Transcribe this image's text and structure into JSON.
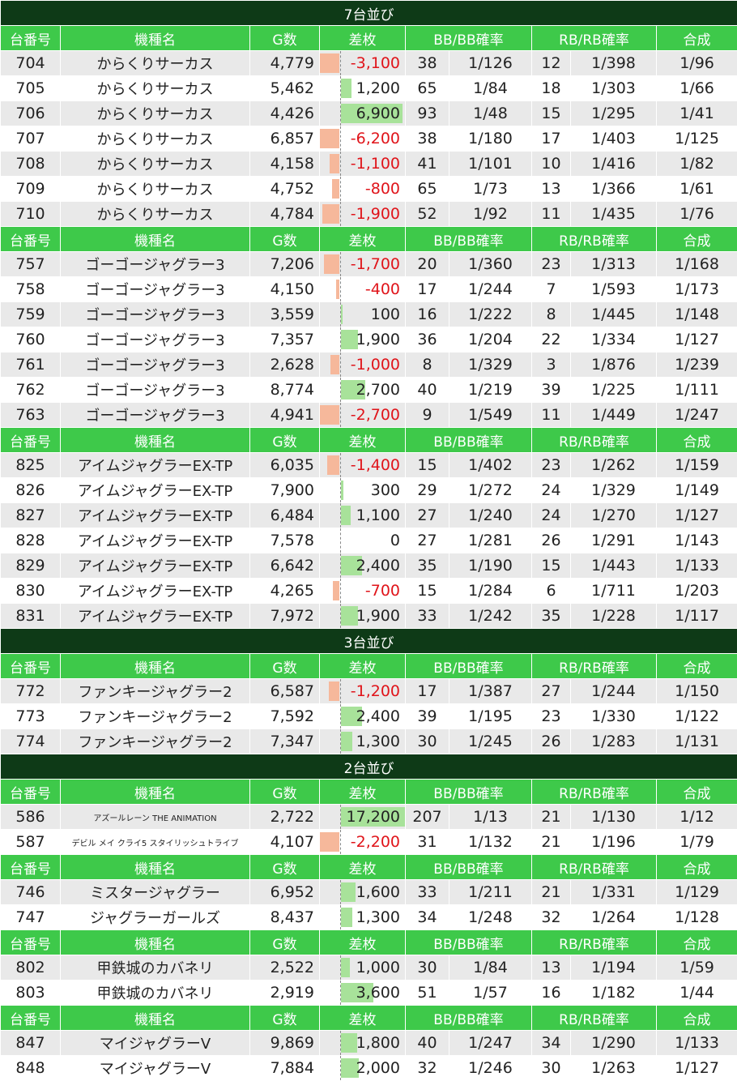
{
  "header": [
    "台番号",
    "機種名",
    "G数",
    "差枚",
    "BB/BB確率",
    "RB/RB確率",
    "合成"
  ],
  "colors": {
    "section_bg": "#0e3a17",
    "header_bg": "#3ec94a",
    "row_alt": "#e9e9e9",
    "positive_bar": "#a8e29a",
    "negative_bar": "#f6b89b",
    "negative_text": "#e0141a"
  },
  "sections": [
    {
      "title": "7台並び",
      "groups": [
        {
          "rows": [
            [
              "704",
              "からくりサーカス",
              "4,779",
              "-3,100",
              "38",
              "1/126",
              "12",
              "1/398",
              "1/96"
            ],
            [
              "705",
              "からくりサーカス",
              "5,462",
              "1,200",
              "65",
              "1/84",
              "18",
              "1/303",
              "1/66"
            ],
            [
              "706",
              "からくりサーカス",
              "4,426",
              "6,900",
              "93",
              "1/48",
              "15",
              "1/295",
              "1/41"
            ],
            [
              "707",
              "からくりサーカス",
              "6,857",
              "-6,200",
              "38",
              "1/180",
              "17",
              "1/403",
              "1/125"
            ],
            [
              "708",
              "からくりサーカス",
              "4,158",
              "-1,100",
              "41",
              "1/101",
              "10",
              "1/416",
              "1/82"
            ],
            [
              "709",
              "からくりサーカス",
              "4,752",
              "-800",
              "65",
              "1/73",
              "13",
              "1/366",
              "1/61"
            ],
            [
              "710",
              "からくりサーカス",
              "4,784",
              "-1,900",
              "52",
              "1/92",
              "11",
              "1/435",
              "1/76"
            ]
          ]
        },
        {
          "rows": [
            [
              "757",
              "ゴーゴージャグラー3",
              "7,206",
              "-1,700",
              "20",
              "1/360",
              "23",
              "1/313",
              "1/168"
            ],
            [
              "758",
              "ゴーゴージャグラー3",
              "4,150",
              "-400",
              "17",
              "1/244",
              "7",
              "1/593",
              "1/173"
            ],
            [
              "759",
              "ゴーゴージャグラー3",
              "3,559",
              "100",
              "16",
              "1/222",
              "8",
              "1/445",
              "1/148"
            ],
            [
              "760",
              "ゴーゴージャグラー3",
              "7,357",
              "1,900",
              "36",
              "1/204",
              "22",
              "1/334",
              "1/127"
            ],
            [
              "761",
              "ゴーゴージャグラー3",
              "2,628",
              "-1,000",
              "8",
              "1/329",
              "3",
              "1/876",
              "1/239"
            ],
            [
              "762",
              "ゴーゴージャグラー3",
              "8,774",
              "2,700",
              "40",
              "1/219",
              "39",
              "1/225",
              "1/111"
            ],
            [
              "763",
              "ゴーゴージャグラー3",
              "4,941",
              "-2,700",
              "9",
              "1/549",
              "11",
              "1/449",
              "1/247"
            ]
          ]
        },
        {
          "rows": [
            [
              "825",
              "アイムジャグラーEX-TP",
              "6,035",
              "-1,400",
              "15",
              "1/402",
              "23",
              "1/262",
              "1/159"
            ],
            [
              "826",
              "アイムジャグラーEX-TP",
              "7,900",
              "300",
              "29",
              "1/272",
              "24",
              "1/329",
              "1/149"
            ],
            [
              "827",
              "アイムジャグラーEX-TP",
              "6,484",
              "1,100",
              "27",
              "1/240",
              "24",
              "1/270",
              "1/127"
            ],
            [
              "828",
              "アイムジャグラーEX-TP",
              "7,578",
              "0",
              "27",
              "1/281",
              "26",
              "1/291",
              "1/143"
            ],
            [
              "829",
              "アイムジャグラーEX-TP",
              "6,642",
              "2,400",
              "35",
              "1/190",
              "15",
              "1/443",
              "1/133"
            ],
            [
              "830",
              "アイムジャグラーEX-TP",
              "4,265",
              "-700",
              "15",
              "1/284",
              "6",
              "1/711",
              "1/203"
            ],
            [
              "831",
              "アイムジャグラーEX-TP",
              "7,972",
              "1,900",
              "33",
              "1/242",
              "35",
              "1/228",
              "1/117"
            ]
          ]
        }
      ]
    },
    {
      "title": "3台並び",
      "groups": [
        {
          "rows": [
            [
              "772",
              "ファンキージャグラー2",
              "6,587",
              "-1,200",
              "17",
              "1/387",
              "27",
              "1/244",
              "1/150"
            ],
            [
              "773",
              "ファンキージャグラー2",
              "7,592",
              "2,400",
              "39",
              "1/195",
              "23",
              "1/330",
              "1/122"
            ],
            [
              "774",
              "ファンキージャグラー2",
              "7,347",
              "1,300",
              "30",
              "1/245",
              "26",
              "1/283",
              "1/131"
            ]
          ]
        }
      ]
    },
    {
      "title": "2台並び",
      "groups": [
        {
          "rows": [
            [
              "586",
              "アズールレーン THE ANIMATION",
              "2,722",
              "17,200",
              "207",
              "1/13",
              "21",
              "1/130",
              "1/12"
            ],
            [
              "587",
              "デビル メイ クライ5 スタイリッシュトライブ",
              "4,107",
              "-2,200",
              "31",
              "1/132",
              "21",
              "1/196",
              "1/79"
            ]
          ]
        },
        {
          "rows": [
            [
              "746",
              "ミスタージャグラー",
              "6,952",
              "1,600",
              "33",
              "1/211",
              "21",
              "1/331",
              "1/129"
            ],
            [
              "747",
              "ジャグラーガールズ",
              "8,437",
              "1,300",
              "34",
              "1/248",
              "32",
              "1/264",
              "1/128"
            ]
          ]
        },
        {
          "rows": [
            [
              "802",
              "甲鉄城のカバネリ",
              "2,522",
              "1,000",
              "30",
              "1/84",
              "13",
              "1/194",
              "1/59"
            ],
            [
              "803",
              "甲鉄城のカバネリ",
              "2,919",
              "3,600",
              "51",
              "1/57",
              "16",
              "1/182",
              "1/44"
            ]
          ]
        },
        {
          "rows": [
            [
              "847",
              "マイジャグラーV",
              "9,869",
              "1,800",
              "40",
              "1/247",
              "34",
              "1/290",
              "1/133"
            ],
            [
              "848",
              "マイジャグラーV",
              "7,884",
              "2,000",
              "32",
              "1/246",
              "30",
              "1/263",
              "1/127"
            ]
          ]
        }
      ]
    }
  ]
}
